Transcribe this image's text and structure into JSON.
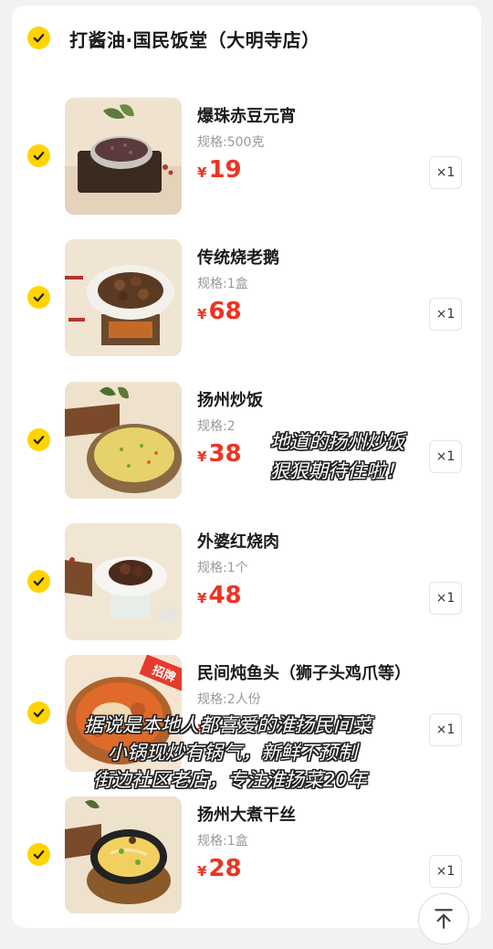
{
  "store": {
    "name": "打酱油·国民饭堂（大明寺店）"
  },
  "items": [
    {
      "name": "爆珠赤豆元宵",
      "spec": "规格:500克",
      "currency": "¥",
      "price": "19",
      "qty": "×1"
    },
    {
      "name": "传统烧老鹅",
      "spec": "规格:1盒",
      "currency": "¥",
      "price": "68",
      "qty": "×1"
    },
    {
      "name": "扬州炒饭",
      "spec": "规格:2",
      "currency": "¥",
      "price": "38",
      "qty": "×1"
    },
    {
      "name": "外婆红烧肉",
      "spec": "规格:1个",
      "currency": "¥",
      "price": "48",
      "qty": "×1"
    },
    {
      "name": "民间炖鱼头（狮子头鸡爪等）",
      "spec": "规格:2人份",
      "currency": "¥",
      "price": "",
      "qty": "×1",
      "badge": "招牌"
    },
    {
      "name": "扬州大煮干丝",
      "spec": "规格:1盒",
      "currency": "¥",
      "price": "28",
      "qty": "×1"
    }
  ],
  "captions": {
    "rice_line1": "地道的扬州炒饭",
    "rice_line2": "狠狠期待住啦！",
    "bottom_line1": "据说是本地人都喜爱的淮扬民间菜",
    "bottom_line2": "小锅现炒有锅气，新鲜不预制",
    "bottom_line3": "街边社区老店，专注淮扬菜20年"
  },
  "icons": {
    "check": "check-icon",
    "scroll_top": "arrow-up-icon"
  },
  "colors": {
    "accent": "#ffd400",
    "price": "#ee3322"
  }
}
